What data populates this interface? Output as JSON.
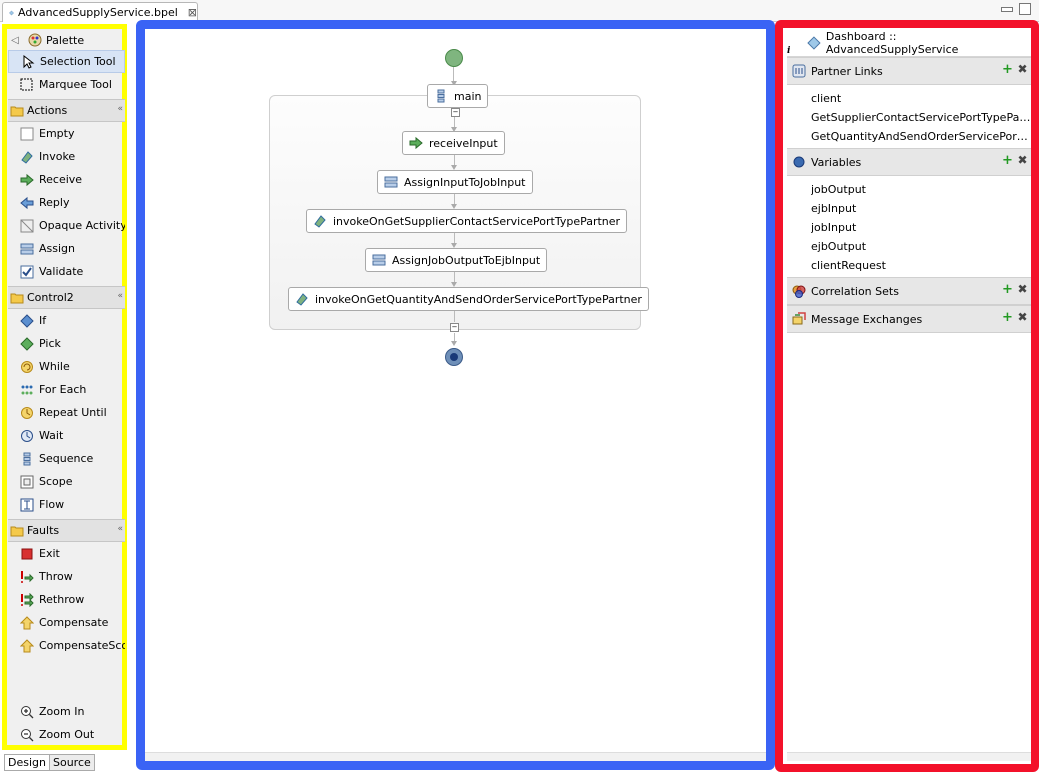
{
  "editor_tab": {
    "title": "AdvancedSupplyService.bpel",
    "close": "⊠"
  },
  "palette": {
    "title": "Palette",
    "tools": [
      {
        "label": "Selection Tool",
        "icon": "arrow-cursor-icon"
      },
      {
        "label": "Marquee Tool",
        "icon": "marquee-icon"
      }
    ],
    "drawers": [
      {
        "label": "Actions",
        "items": [
          "Empty",
          "Invoke",
          "Receive",
          "Reply",
          "Opaque Activity",
          "Assign",
          "Validate"
        ]
      },
      {
        "label": "Control2",
        "items": [
          "If",
          "Pick",
          "While",
          "For Each",
          "Repeat Until",
          "Wait",
          "Sequence",
          "Scope",
          "Flow"
        ]
      },
      {
        "label": "Faults",
        "items": [
          "Exit",
          "Throw",
          "Rethrow",
          "Compensate",
          "CompensateScope"
        ]
      }
    ],
    "zoom_in": "Zoom In",
    "zoom_out": "Zoom Out"
  },
  "bottom_tabs": [
    "Design",
    "Source"
  ],
  "process": {
    "sequence_label": "main",
    "activities": [
      {
        "label": "receiveInput",
        "type": "receive"
      },
      {
        "label": "AssignInputToJobInput",
        "type": "assign"
      },
      {
        "label": "invokeOnGetSupplierContactServicePortTypePartner",
        "type": "invoke"
      },
      {
        "label": "AssignJobOutputToEjbInput",
        "type": "assign"
      },
      {
        "label": "invokeOnGetQuantityAndSendOrderServicePortTypePartner",
        "type": "invoke"
      }
    ]
  },
  "dashboard": {
    "title": "Dashboard :: AdvancedSupplyService",
    "info": "i",
    "sections": [
      {
        "label": "Partner Links",
        "items": [
          "client",
          "GetSupplierContactServicePortTypePartner",
          "GetQuantityAndSendOrderServicePortTypePartner"
        ]
      },
      {
        "label": "Variables",
        "items": [
          "jobOutput",
          "ejbInput",
          "jobInput",
          "ejbOutput",
          "clientRequest"
        ]
      },
      {
        "label": "Correlation Sets",
        "items": []
      },
      {
        "label": "Message Exchanges",
        "items": []
      }
    ]
  },
  "colors": {
    "highlight_palette": "#ffff00",
    "highlight_canvas": "#3a63f5",
    "highlight_dashboard": "#f3112a"
  }
}
